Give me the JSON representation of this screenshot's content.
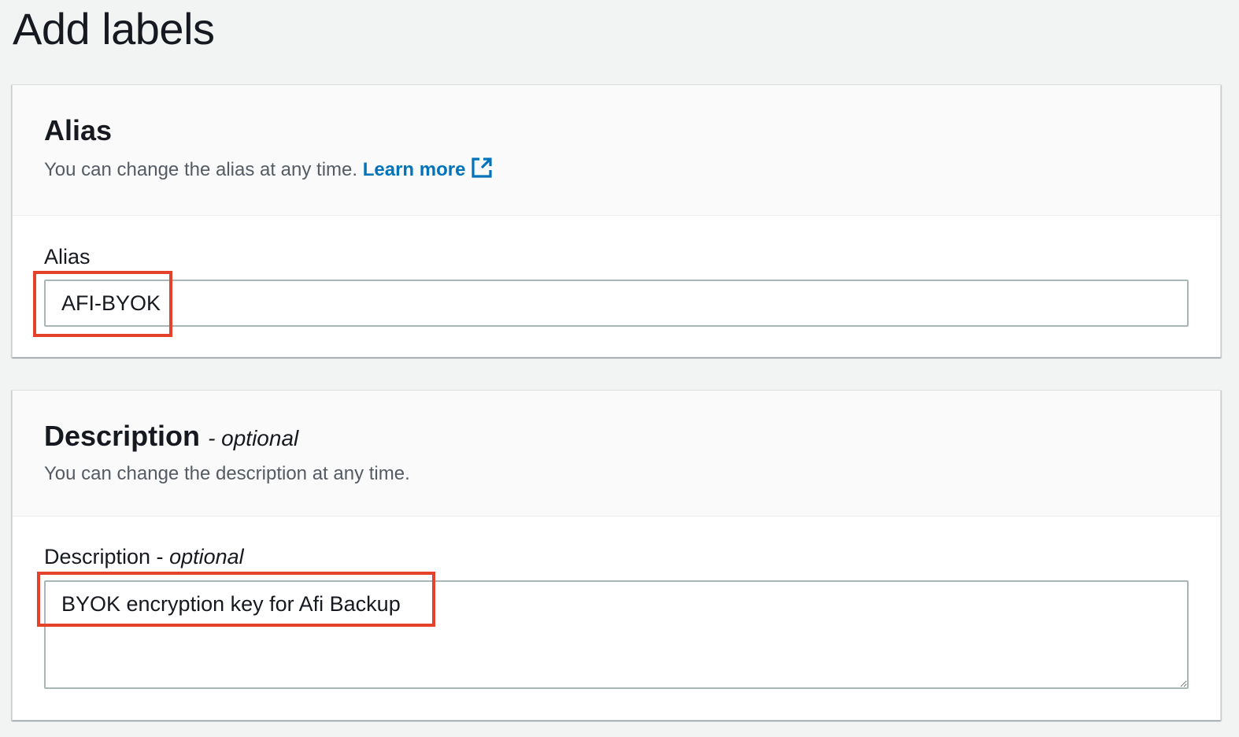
{
  "page": {
    "title": "Add labels"
  },
  "alias_section": {
    "title": "Alias",
    "description": "You can change the alias at any time.",
    "learn_more": "Learn more",
    "learn_more_icon": "external-link-icon",
    "field_label": "Alias",
    "field_value": "AFI-BYOK"
  },
  "description_section": {
    "title": "Description",
    "title_suffix": "- optional",
    "description": "You can change the description at any time.",
    "field_label": "Description -",
    "field_label_optional": "optional",
    "field_value": "BYOK encryption key for Afi Backup"
  },
  "colors": {
    "link": "#0073bb",
    "highlight": "#e4422b",
    "background": "#f2f3f3"
  }
}
